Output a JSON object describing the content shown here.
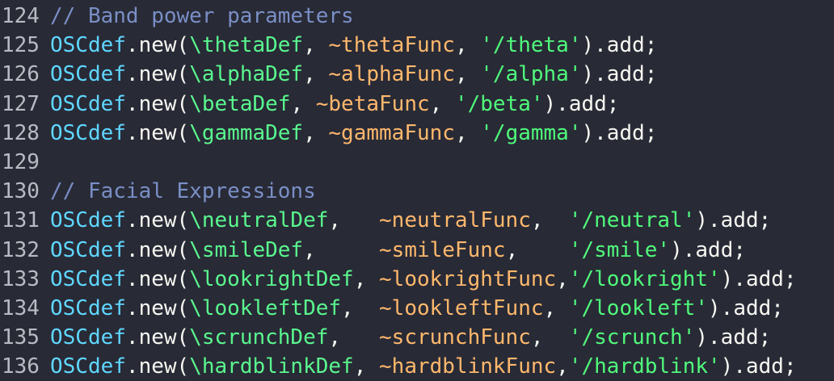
{
  "editor": {
    "lines": [
      {
        "number": "124",
        "tokens": [
          {
            "text": "// Band power parameters",
            "cls": "comment"
          }
        ]
      },
      {
        "number": "125",
        "tokens": [
          {
            "text": "OSCdef",
            "cls": "class"
          },
          {
            "text": ".new(",
            "cls": "plain"
          },
          {
            "text": "\\thetaDef",
            "cls": "symbol"
          },
          {
            "text": ", ",
            "cls": "plain"
          },
          {
            "text": "~thetaFunc",
            "cls": "env"
          },
          {
            "text": ", ",
            "cls": "plain"
          },
          {
            "text": "'/theta'",
            "cls": "string"
          },
          {
            "text": ").add;",
            "cls": "plain"
          }
        ]
      },
      {
        "number": "126",
        "tokens": [
          {
            "text": "OSCdef",
            "cls": "class"
          },
          {
            "text": ".new(",
            "cls": "plain"
          },
          {
            "text": "\\alphaDef",
            "cls": "symbol"
          },
          {
            "text": ", ",
            "cls": "plain"
          },
          {
            "text": "~alphaFunc",
            "cls": "env"
          },
          {
            "text": ", ",
            "cls": "plain"
          },
          {
            "text": "'/alpha'",
            "cls": "string"
          },
          {
            "text": ").add;",
            "cls": "plain"
          }
        ]
      },
      {
        "number": "127",
        "tokens": [
          {
            "text": "OSCdef",
            "cls": "class"
          },
          {
            "text": ".new(",
            "cls": "plain"
          },
          {
            "text": "\\betaDef",
            "cls": "symbol"
          },
          {
            "text": ", ",
            "cls": "plain"
          },
          {
            "text": "~betaFunc",
            "cls": "env"
          },
          {
            "text": ", ",
            "cls": "plain"
          },
          {
            "text": "'/beta'",
            "cls": "string"
          },
          {
            "text": ").add;",
            "cls": "plain"
          }
        ]
      },
      {
        "number": "128",
        "tokens": [
          {
            "text": "OSCdef",
            "cls": "class"
          },
          {
            "text": ".new(",
            "cls": "plain"
          },
          {
            "text": "\\gammaDef",
            "cls": "symbol"
          },
          {
            "text": ", ",
            "cls": "plain"
          },
          {
            "text": "~gammaFunc",
            "cls": "env"
          },
          {
            "text": ", ",
            "cls": "plain"
          },
          {
            "text": "'/gamma'",
            "cls": "string"
          },
          {
            "text": ").add;",
            "cls": "plain"
          }
        ]
      },
      {
        "number": "129",
        "tokens": []
      },
      {
        "number": "130",
        "tokens": [
          {
            "text": "// Facial Expressions",
            "cls": "comment"
          }
        ]
      },
      {
        "number": "131",
        "tokens": [
          {
            "text": "OSCdef",
            "cls": "class"
          },
          {
            "text": ".new(",
            "cls": "plain"
          },
          {
            "text": "\\neutralDef",
            "cls": "symbol"
          },
          {
            "text": ",   ",
            "cls": "plain"
          },
          {
            "text": "~neutralFunc",
            "cls": "env"
          },
          {
            "text": ",  ",
            "cls": "plain"
          },
          {
            "text": "'/neutral'",
            "cls": "string"
          },
          {
            "text": ").add;",
            "cls": "plain"
          }
        ]
      },
      {
        "number": "132",
        "tokens": [
          {
            "text": "OSCdef",
            "cls": "class"
          },
          {
            "text": ".new(",
            "cls": "plain"
          },
          {
            "text": "\\smileDef",
            "cls": "symbol"
          },
          {
            "text": ",     ",
            "cls": "plain"
          },
          {
            "text": "~smileFunc",
            "cls": "env"
          },
          {
            "text": ",    ",
            "cls": "plain"
          },
          {
            "text": "'/smile'",
            "cls": "string"
          },
          {
            "text": ").add;",
            "cls": "plain"
          }
        ]
      },
      {
        "number": "133",
        "tokens": [
          {
            "text": "OSCdef",
            "cls": "class"
          },
          {
            "text": ".new(",
            "cls": "plain"
          },
          {
            "text": "\\lookrightDef",
            "cls": "symbol"
          },
          {
            "text": ", ",
            "cls": "plain"
          },
          {
            "text": "~lookrightFunc",
            "cls": "env"
          },
          {
            "text": ",",
            "cls": "plain"
          },
          {
            "text": "'/lookright'",
            "cls": "string"
          },
          {
            "text": ").add;",
            "cls": "plain"
          }
        ]
      },
      {
        "number": "134",
        "tokens": [
          {
            "text": "OSCdef",
            "cls": "class"
          },
          {
            "text": ".new(",
            "cls": "plain"
          },
          {
            "text": "\\lookleftDef",
            "cls": "symbol"
          },
          {
            "text": ",  ",
            "cls": "plain"
          },
          {
            "text": "~lookleftFunc",
            "cls": "env"
          },
          {
            "text": ", ",
            "cls": "plain"
          },
          {
            "text": "'/lookleft'",
            "cls": "string"
          },
          {
            "text": ").add;",
            "cls": "plain"
          }
        ]
      },
      {
        "number": "135",
        "tokens": [
          {
            "text": "OSCdef",
            "cls": "class"
          },
          {
            "text": ".new(",
            "cls": "plain"
          },
          {
            "text": "\\scrunchDef",
            "cls": "symbol"
          },
          {
            "text": ",   ",
            "cls": "plain"
          },
          {
            "text": "~scrunchFunc",
            "cls": "env"
          },
          {
            "text": ",  ",
            "cls": "plain"
          },
          {
            "text": "'/scrunch'",
            "cls": "string"
          },
          {
            "text": ").add;",
            "cls": "plain"
          }
        ]
      },
      {
        "number": "136",
        "tokens": [
          {
            "text": "OSCdef",
            "cls": "class"
          },
          {
            "text": ".new(",
            "cls": "plain"
          },
          {
            "text": "\\hardblinkDef",
            "cls": "symbol"
          },
          {
            "text": ", ",
            "cls": "plain"
          },
          {
            "text": "~hardblinkFunc",
            "cls": "env"
          },
          {
            "text": ",",
            "cls": "plain"
          },
          {
            "text": "'/hardblink'",
            "cls": "string"
          },
          {
            "text": ").add;",
            "cls": "plain"
          }
        ]
      }
    ]
  }
}
